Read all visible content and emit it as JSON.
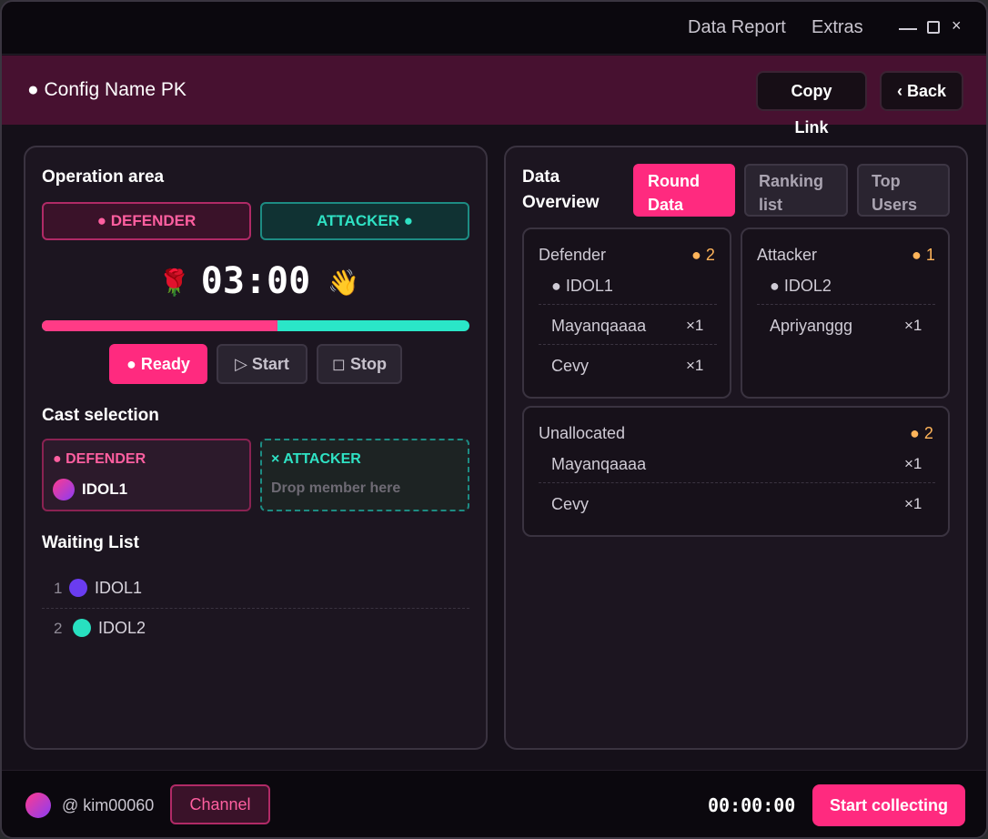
{
  "titlebar": {
    "menu": [
      "Data Report",
      "Extras"
    ],
    "close_glyph": "×"
  },
  "header": {
    "title": "● Config Name PK",
    "copy_link": "Copy Link",
    "back": "‹ Back",
    "bg_color": "#471130"
  },
  "operation": {
    "title": "Operation area",
    "defender_label": "● DEFENDER",
    "attacker_label": "ATTACKER ●",
    "timer": "03:00",
    "timer_left_icon": "🌹",
    "timer_right_icon": "👋",
    "defender_share": 0.55,
    "buttons": {
      "ready": "● Ready",
      "start": "▷ Start",
      "stop": "◻ Stop"
    }
  },
  "cast": {
    "title": "Cast selection",
    "defender": {
      "label": "● DEFENDER",
      "member": "IDOL1"
    },
    "attacker": {
      "label": "× ATTACKER",
      "placeholder": "Drop member here"
    }
  },
  "waiting": {
    "title": "Waiting List",
    "items": [
      {
        "num": "1",
        "name": "IDOL1",
        "color": "#6a3cf0"
      },
      {
        "num": "2",
        "name": "IDOL2",
        "color": "#28e0c0"
      }
    ]
  },
  "overview": {
    "title_line1": "Data",
    "title_line2": "Overview",
    "tabs": [
      {
        "line1": "Round",
        "line2": "Data"
      },
      {
        "line1": "Ranking",
        "line2": "list"
      },
      {
        "line1": "Top",
        "line2": "Users"
      }
    ],
    "defender": {
      "title": "Defender",
      "count": "● 2",
      "head": "● IDOL1",
      "rows": [
        {
          "name": "Mayanqaaaa",
          "mult": "×1"
        },
        {
          "name": "Cevy",
          "mult": "×1"
        }
      ]
    },
    "attacker": {
      "title": "Attacker",
      "count": "● 1",
      "head": "● IDOL2",
      "rows": [
        {
          "name": "Apriyanggg",
          "mult": "×1"
        }
      ]
    },
    "unallocated": {
      "title": "Unallocated",
      "count": "● 2",
      "rows": [
        {
          "name": "Mayanqaaaa",
          "mult": "×1"
        },
        {
          "name": "Cevy",
          "mult": "×1"
        }
      ]
    }
  },
  "footer": {
    "user": "@ kim00060",
    "channel": "Channel",
    "timer": "00:00:00",
    "collect": "Start collecting"
  },
  "colors": {
    "accent": "#ff2a7f",
    "attacker": "#2ae6c8",
    "count": "#ffb45a"
  }
}
